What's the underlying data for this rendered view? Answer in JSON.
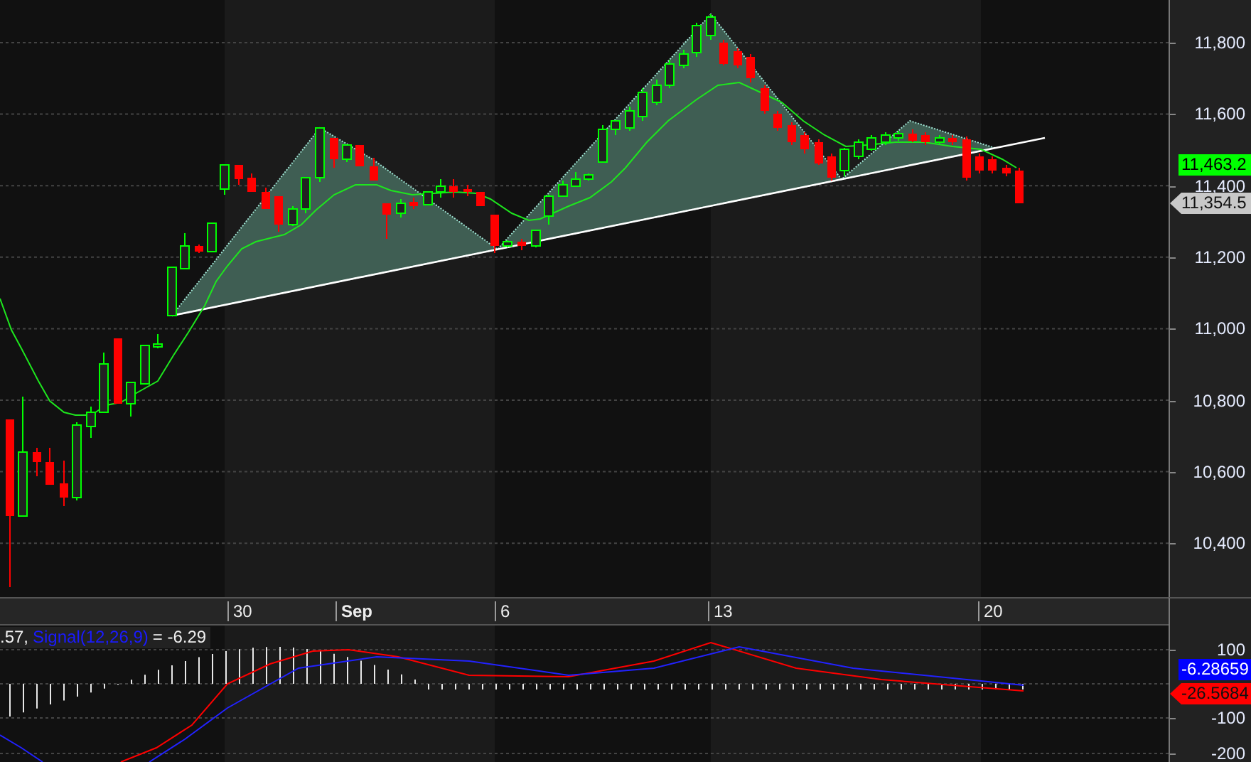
{
  "price_axis": {
    "ticks": [
      "11,800",
      "11,600",
      "11,400",
      "11,200",
      "11,000",
      "10,800",
      "10,600",
      "10,400"
    ],
    "last_price": "11,463.2",
    "marker_price": "11,354.5"
  },
  "date_axis": {
    "labels": [
      {
        "text": "30",
        "kind": "day"
      },
      {
        "text": "Sep",
        "kind": "month"
      },
      {
        "text": "6",
        "kind": "day"
      },
      {
        "text": "13",
        "kind": "day"
      },
      {
        "text": "20",
        "kind": "day"
      }
    ]
  },
  "macd": {
    "legend": {
      "value": ".57,",
      "signal_name": "Signal(12,26,9)",
      "signal_value": "= -6.29"
    },
    "ticks": [
      "100",
      "-100",
      "-200"
    ],
    "signal_reading": "-6.28659",
    "macd_reading": "-26.5684"
  }
}
